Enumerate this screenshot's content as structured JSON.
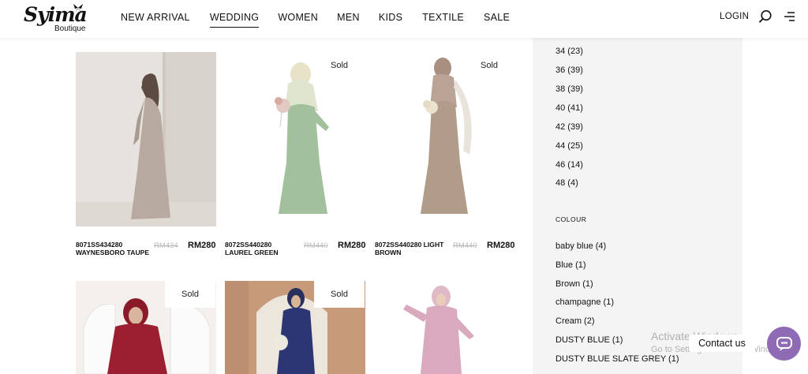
{
  "logo": {
    "main": "Syima",
    "sub": "Boutique"
  },
  "nav": {
    "items": [
      {
        "label": "NEW ARRIVAL"
      },
      {
        "label": "WEDDING",
        "active": true
      },
      {
        "label": "WOMEN"
      },
      {
        "label": "MEN"
      },
      {
        "label": "KIDS"
      },
      {
        "label": "TEXTILE"
      },
      {
        "label": "SALE"
      }
    ],
    "login": "LOGIN"
  },
  "products": [
    {
      "name": "8071SS434280 WAYNESBORO TAUPE",
      "old_price": "RM434",
      "price": "RM280",
      "sold": ""
    },
    {
      "name": "8072SS440280 LAUREL GREEN",
      "old_price": "RM440",
      "price": "RM280",
      "sold": "Sold"
    },
    {
      "name": "8072SS440280 LIGHT BROWN",
      "old_price": "RM440",
      "price": "RM280",
      "sold": "Sold"
    },
    {
      "name": "",
      "old_price": "",
      "price": "",
      "sold": "Sold"
    },
    {
      "name": "",
      "old_price": "",
      "price": "",
      "sold": "Sold"
    },
    {
      "name": "",
      "old_price": "",
      "price": "",
      "sold": ""
    }
  ],
  "filters": {
    "sizes": [
      "34 (23)",
      "36 (39)",
      "38 (39)",
      "40 (41)",
      "42 (39)",
      "44 (25)",
      "46 (14)",
      "48 (4)"
    ],
    "colour_heading": "COLOUR",
    "colours": [
      "baby blue (4)",
      "Blue (1)",
      "Brown (1)",
      "champagne (1)",
      "Cream (2)",
      "DUSTY BLUE (1)",
      "DUSTY BLUE SLATE GREY (1)"
    ]
  },
  "overlay": {
    "watermark_title": "Activate Windows",
    "watermark_sub": "Go to Settings to activate Windows.",
    "contact": "Contact us"
  },
  "colors": {
    "sidebar_bg": "#f4f4f4",
    "chat_bg": "#8f6bb5"
  },
  "icons": [
    "search-icon",
    "menu-icon",
    "chat-icon",
    "butterfly-icon"
  ]
}
